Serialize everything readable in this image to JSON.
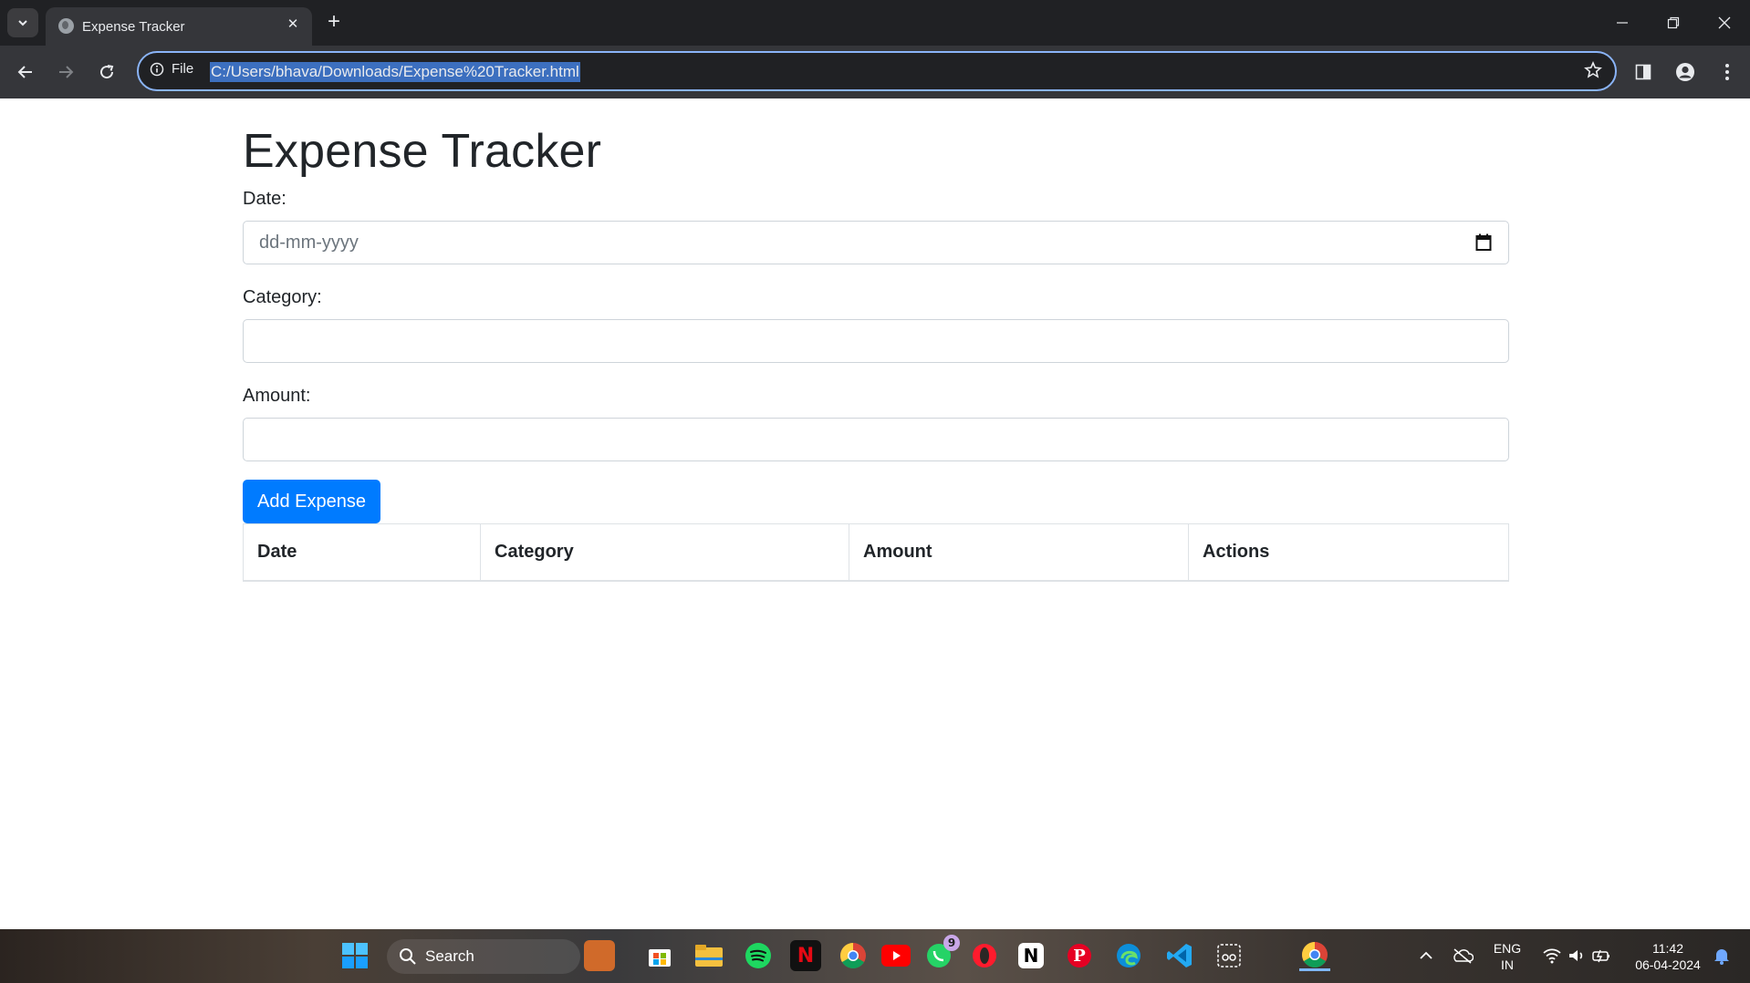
{
  "browser": {
    "tab_title": "Expense Tracker",
    "site_info_label": "File",
    "url": "C:/Users/bhava/Downloads/Expense%20Tracker.html"
  },
  "page": {
    "heading": "Expense Tracker",
    "date_label": "Date:",
    "date_placeholder": "dd-mm-yyyy",
    "category_label": "Category:",
    "category_value": "",
    "amount_label": "Amount:",
    "amount_value": "",
    "add_button": "Add Expense",
    "table_headers": [
      "Date",
      "Category",
      "Amount",
      "Actions"
    ],
    "table_rows": []
  },
  "taskbar": {
    "search_label": "Search",
    "whatsapp_badge": "9",
    "language": "ENG",
    "region": "IN",
    "time": "11:42",
    "date": "06-04-2024",
    "accent_color": "#007bff"
  }
}
